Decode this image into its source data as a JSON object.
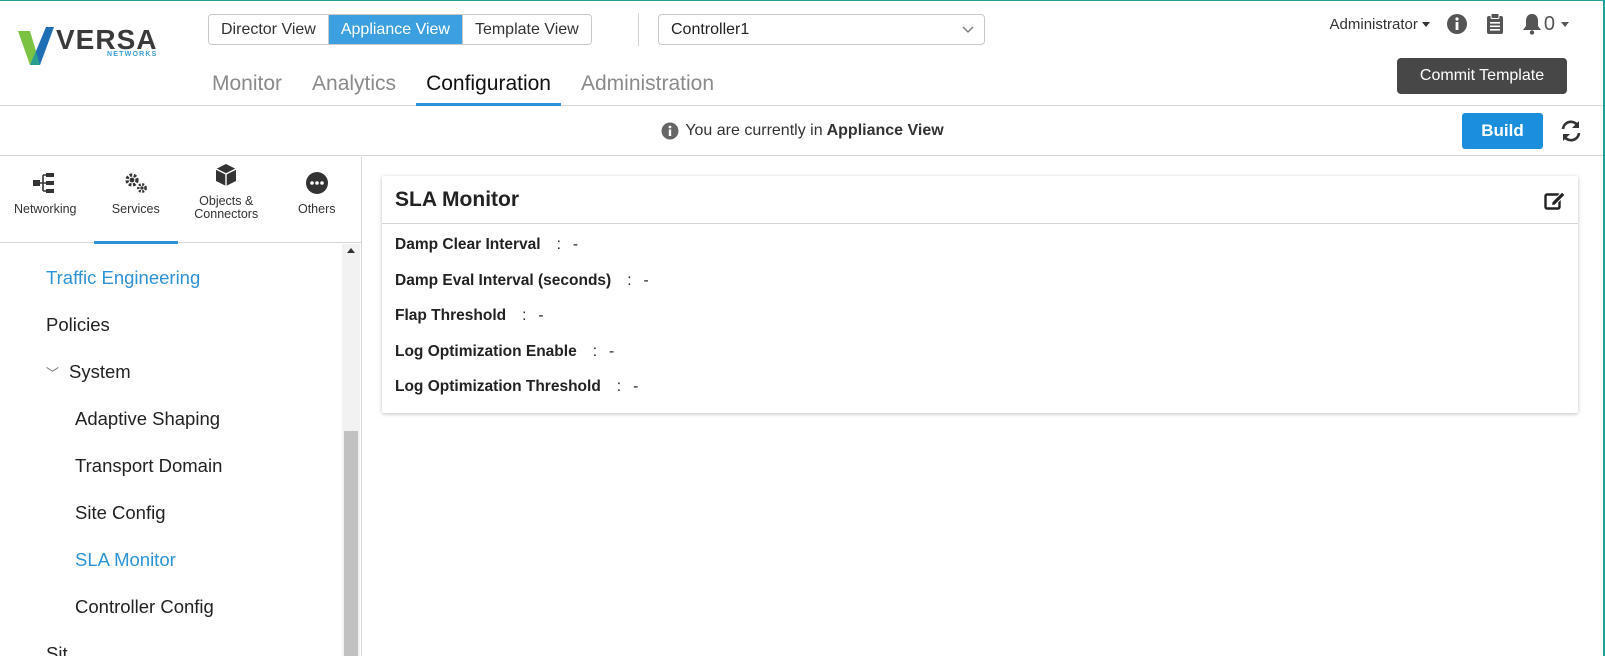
{
  "logo": {
    "name": "VERSA",
    "sub": "NETWORKS"
  },
  "view_switch": [
    "Director View",
    "Appliance View",
    "Template View"
  ],
  "controller_select": {
    "value": "Controller1"
  },
  "main_nav": [
    "Monitor",
    "Analytics",
    "Configuration",
    "Administration"
  ],
  "user": {
    "name": "Administrator",
    "bell_count": "0"
  },
  "commit_label": "Commit Template",
  "infobar": {
    "prefix": "You are currently in",
    "bold": "Appliance View"
  },
  "build_label": "Build",
  "category_tabs": [
    {
      "label1": "Networking",
      "label2": ""
    },
    {
      "label1": "Services",
      "label2": ""
    },
    {
      "label1": "Objects &",
      "label2": "Connectors"
    },
    {
      "label1": "Others",
      "label2": ""
    }
  ],
  "tree": {
    "traffic_engineering": "Traffic Engineering",
    "policies": "Policies",
    "system": "System",
    "adaptive_shaping": "Adaptive Shaping",
    "transport_domain": "Transport Domain",
    "site_config": "Site Config",
    "sla_monitor": "SLA Monitor",
    "controller_config": "Controller Config",
    "partial": "Sit..."
  },
  "card": {
    "title": "SLA Monitor",
    "rows": [
      {
        "label": "Damp Clear Interval",
        "value": "-"
      },
      {
        "label": "Damp Eval Interval (seconds)",
        "value": "-"
      },
      {
        "label": "Flap Threshold",
        "value": "-"
      },
      {
        "label": "Log Optimization Enable",
        "value": "-"
      },
      {
        "label": "Log Optimization Threshold",
        "value": "-"
      }
    ]
  },
  "colors": {
    "accent": "#2d93d6",
    "active_view": "#3c9fe0",
    "build": "#1b8fdc",
    "commit": "#474747"
  }
}
